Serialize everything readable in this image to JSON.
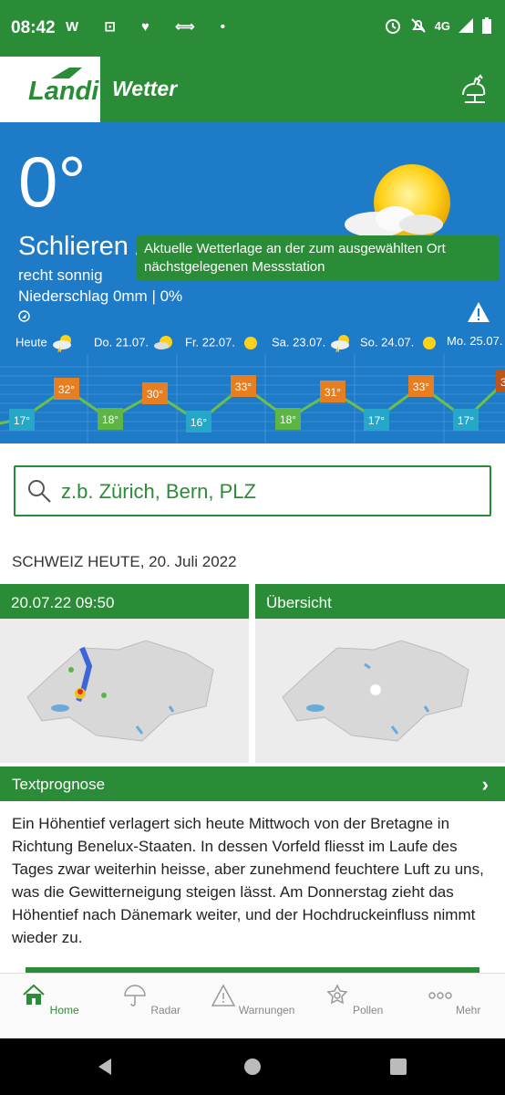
{
  "status": {
    "time": "08:42",
    "left_icons": "W ⊡ ♥ ⟺ •",
    "network": "4G"
  },
  "app": {
    "logo": "Landi",
    "title": "Wetter"
  },
  "current": {
    "temp": "0°",
    "place": "Schlieren / Hühlen",
    "condition": "recht sonnig",
    "precip": "Niederschlag 0mm | 0%",
    "tooltip": "Aktuelle Wetterlage an der zum ausgewählten Ort nächstgelegenen Messstation"
  },
  "forecast": {
    "days": [
      "Heute",
      "Do. 21.07.",
      "Fr. 22.07.",
      "Sa. 23.07.",
      "So. 24.07.",
      "Mo. 25.07."
    ],
    "max": [
      "32°",
      "30°",
      "33°",
      "31°",
      "33°",
      "3"
    ],
    "min": [
      "17°",
      "18°",
      "16°",
      "18°",
      "17°",
      "17°"
    ],
    "colors": {
      "max": "#e67e22",
      "min_blue": "#26a6c9",
      "min_green": "#5cb544",
      "line": "#6cc04a"
    }
  },
  "search": {
    "placeholder": "z.b. Zürich, Bern, PLZ"
  },
  "today": {
    "heading": "SCHWEIZ HEUTE, 20. Juli 2022",
    "cards": [
      {
        "title": "20.07.22 09:50"
      },
      {
        "title": "Übersicht"
      }
    ]
  },
  "textprognose": {
    "title": "Textprognose",
    "body": "Ein Höhentief verlagert sich heute Mittwoch von der Bretagne in Richtung Benelux-Staaten. In dessen Vorfeld fliesst im Laufe des Tages zwar weiterhin heisse, aber zunehmend feuchtere Luft zu uns, was die Gewitterneigung steigen lässt. Am Donnerstag zieht das Höhentief nach Dänemark weiter, und der Hochdruckeinfluss nimmt wieder zu."
  },
  "nav": [
    {
      "label": "Home",
      "icon": "home-icon"
    },
    {
      "label": "Radar",
      "icon": "umbrella-icon"
    },
    {
      "label": "Warnungen",
      "icon": "warning-icon"
    },
    {
      "label": "Pollen",
      "icon": "flower-icon"
    },
    {
      "label": "Mehr",
      "icon": "more-icon"
    }
  ],
  "theme": {
    "green": "#2a8c37",
    "blue": "#1e7bc8"
  }
}
